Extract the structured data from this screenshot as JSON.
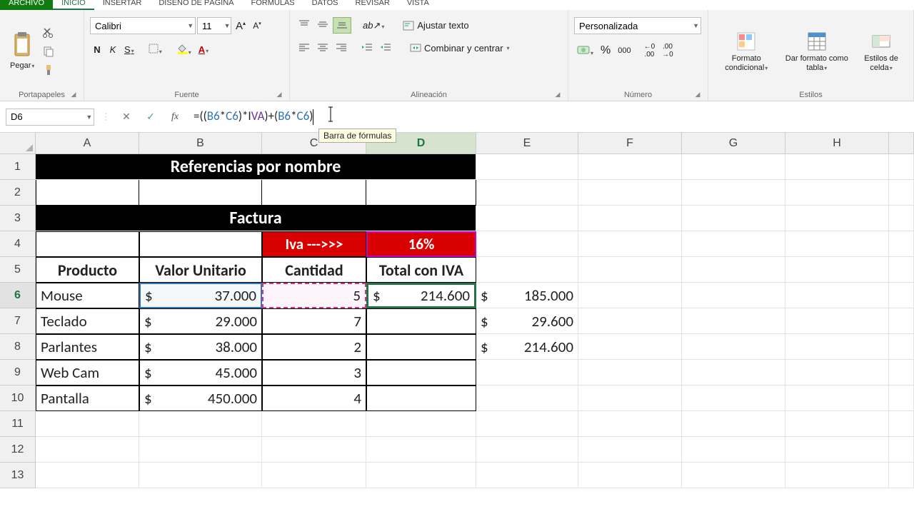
{
  "tabs": {
    "file": "ARCHIVO",
    "home": "INICIO",
    "insert": "INSERTAR",
    "pageLayout": "DISEÑO DE PÁGINA",
    "formulas": "FÓRMULAS",
    "data": "DATOS",
    "review": "REVISAR",
    "view": "VISTA"
  },
  "ribbon": {
    "clipboard": {
      "paste": "Pegar",
      "label": "Portapapeles"
    },
    "font": {
      "name": "Calibri",
      "size": "11",
      "bold": "N",
      "italic": "K",
      "underline": "S",
      "label": "Fuente"
    },
    "align": {
      "wrap": "Ajustar texto",
      "merge": "Combinar y centrar",
      "label": "Alineación"
    },
    "number": {
      "format": "Personalizada",
      "percent": "%",
      "comma": "000",
      "label": "Número"
    },
    "styles": {
      "cond": "Formato condicional",
      "table": "Dar formato como tabla",
      "cell": "Estilos de celda",
      "label": "Estilos"
    }
  },
  "formulaBar": {
    "nameBox": "D6",
    "formulaPlain": "=((B6*C6)*IVA)+(B6*C6)",
    "tooltip": "Barra de fórmulas"
  },
  "columns": [
    "A",
    "B",
    "C",
    "D",
    "E",
    "F",
    "G",
    "H"
  ],
  "sheet": {
    "title1": "Referencias por nombre",
    "title2": "Factura",
    "ivaLabel": "Iva --->>>",
    "ivaValue": "16%",
    "headers": {
      "prod": "Producto",
      "unit": "Valor Unitario",
      "qty": "Cantidad",
      "total": "Total con IVA"
    },
    "rows": [
      {
        "prod": "Mouse",
        "unit": "37.000",
        "qty": "5",
        "total": "214.600"
      },
      {
        "prod": "Teclado",
        "unit": "29.000",
        "qty": "7",
        "total": ""
      },
      {
        "prod": "Parlantes",
        "unit": "38.000",
        "qty": "2",
        "total": ""
      },
      {
        "prod": "Web Cam",
        "unit": "45.000",
        "qty": "3",
        "total": ""
      },
      {
        "prod": "Pantalla",
        "unit": "450.000",
        "qty": "4",
        "total": ""
      }
    ],
    "colE": [
      "185.000",
      "29.600",
      "214.600"
    ],
    "currency": "$"
  }
}
